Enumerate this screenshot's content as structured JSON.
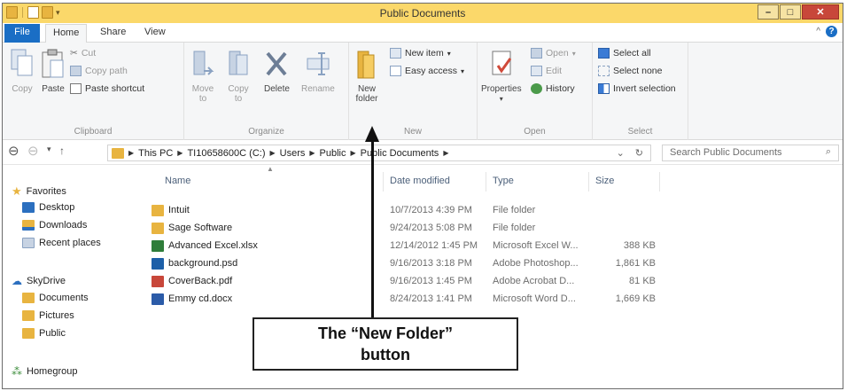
{
  "window": {
    "title": "Public Documents"
  },
  "tabs": {
    "file": "File",
    "home": "Home",
    "share": "Share",
    "view": "View"
  },
  "ribbon": {
    "clipboard": {
      "label": "Clipboard",
      "copy": "Copy",
      "paste": "Paste",
      "cut": "Cut",
      "copy_path": "Copy path",
      "paste_shortcut": "Paste shortcut"
    },
    "organize": {
      "label": "Organize",
      "move_to_1": "Move",
      "move_to_2": "to",
      "copy_to_1": "Copy",
      "copy_to_2": "to",
      "delete": "Delete",
      "rename": "Rename"
    },
    "new": {
      "label": "New",
      "new_folder_1": "New",
      "new_folder_2": "folder",
      "new_item": "New item",
      "easy_access": "Easy access"
    },
    "open": {
      "label": "Open",
      "properties": "Properties",
      "open": "Open",
      "edit": "Edit",
      "history": "History"
    },
    "select": {
      "label": "Select",
      "select_all": "Select all",
      "select_none": "Select none",
      "invert_selection": "Invert selection"
    }
  },
  "address": {
    "crumbs": [
      "This PC",
      "TI10658600C (C:)",
      "Users",
      "Public",
      "Public Documents"
    ],
    "search_placeholder": "Search Public Documents"
  },
  "nav": {
    "favorites": "Favorites",
    "desktop": "Desktop",
    "downloads": "Downloads",
    "recent_places": "Recent places",
    "skydrive": "SkyDrive",
    "documents": "Documents",
    "pictures": "Pictures",
    "public": "Public",
    "homegroup": "Homegroup"
  },
  "filelist": {
    "headers": {
      "name": "Name",
      "date": "Date modified",
      "type": "Type",
      "size": "Size"
    },
    "rows": [
      {
        "name": "Intuit",
        "date": "10/7/2013 4:39 PM",
        "type": "File folder",
        "size": "",
        "icon": "folder-icon",
        "color": "#e8b440"
      },
      {
        "name": "Sage Software",
        "date": "9/24/2013 5:08 PM",
        "type": "File folder",
        "size": "",
        "icon": "folder-icon",
        "color": "#e8b440"
      },
      {
        "name": "Advanced Excel.xlsx",
        "date": "12/14/2012 1:45 PM",
        "type": "Microsoft Excel W...",
        "size": "388 KB",
        "icon": "excel-file-icon",
        "color": "#2f7d3a"
      },
      {
        "name": "background.psd",
        "date": "9/16/2013 3:18 PM",
        "type": "Adobe Photoshop...",
        "size": "1,861 KB",
        "icon": "photoshop-file-icon",
        "color": "#1d5fa8"
      },
      {
        "name": "CoverBack.pdf",
        "date": "9/16/2013 1:45 PM",
        "type": "Adobe Acrobat D...",
        "size": "81 KB",
        "icon": "pdf-file-icon",
        "color": "#c8473a"
      },
      {
        "name": "Emmy cd.docx",
        "date": "8/24/2013 1:41 PM",
        "type": "Microsoft Word D...",
        "size": "1,669 KB",
        "icon": "word-file-icon",
        "color": "#2b5ba8"
      }
    ]
  },
  "callout": {
    "line1": "The “New Folder”",
    "line2": "button"
  },
  "colors": {
    "titlebar": "#fbd86a",
    "file_tab": "#1a6ec5",
    "folder": "#e8b440"
  }
}
